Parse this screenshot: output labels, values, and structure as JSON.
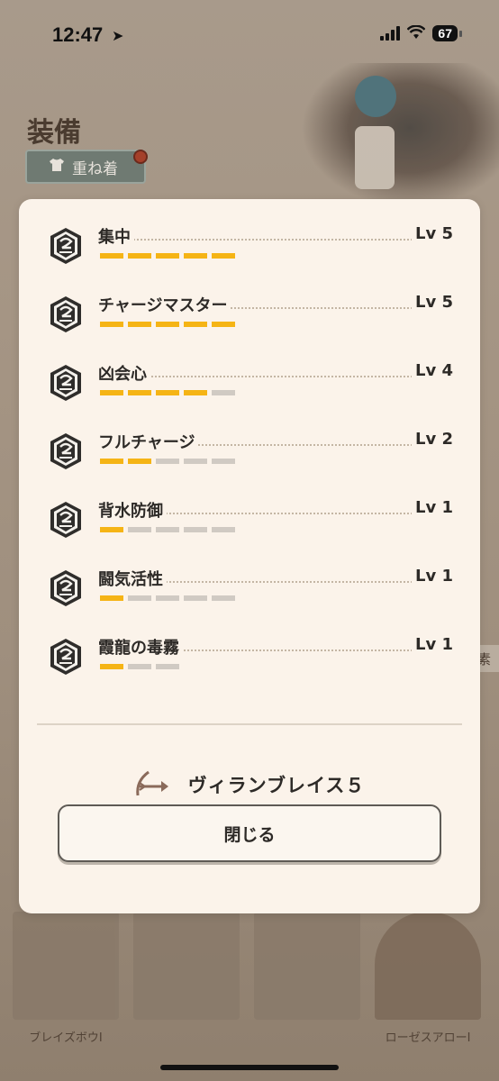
{
  "status_bar": {
    "time": "12:47",
    "battery": "67"
  },
  "background": {
    "title": "装備",
    "layer_button": "重ね着",
    "side_tag": "素",
    "bottom_items": [
      "ブレイズボウI",
      "",
      "",
      "ローゼスアローI"
    ]
  },
  "skills": [
    {
      "name": "集中",
      "level": "Lv 5",
      "filled": 5,
      "max": 5
    },
    {
      "name": "チャージマスター",
      "level": "Lv 5",
      "filled": 5,
      "max": 5
    },
    {
      "name": "凶会心",
      "level": "Lv 4",
      "filled": 4,
      "max": 5
    },
    {
      "name": "フルチャージ",
      "level": "Lv 2",
      "filled": 2,
      "max": 5
    },
    {
      "name": "背水防御",
      "level": "Lv 1",
      "filled": 1,
      "max": 5
    },
    {
      "name": "闘気活性",
      "level": "Lv 1",
      "filled": 1,
      "max": 5
    },
    {
      "name": "霞龍の毒霧",
      "level": "Lv 1",
      "filled": 1,
      "max": 3
    }
  ],
  "weapon": {
    "name": "ヴィランブレイス５",
    "icon": "bow-arrow-icon"
  },
  "close_label": "閉じる",
  "colors": {
    "bar_on": "#f5b415",
    "bar_off": "#d0cac3",
    "modal_bg": "#fbf3ea"
  }
}
